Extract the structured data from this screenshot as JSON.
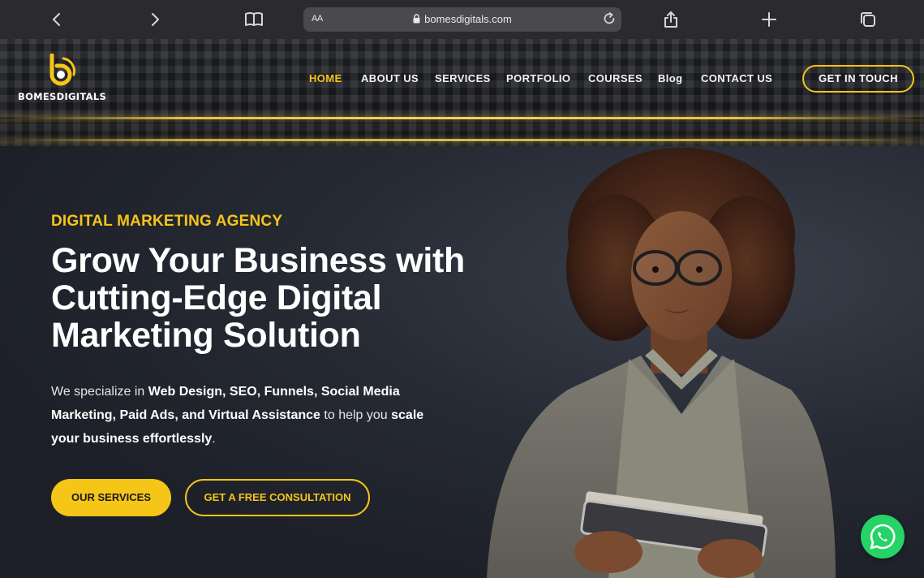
{
  "browser": {
    "url": "bomesdigitals.com",
    "text_size_label": "AA"
  },
  "logo": {
    "text": "BOMESDIGITALS",
    "mark_letter": "b"
  },
  "nav": {
    "items": [
      {
        "label": "HOME",
        "active": true
      },
      {
        "label": "ABOUT US",
        "active": false
      },
      {
        "label": "SERVICES",
        "active": false
      },
      {
        "label": "PORTFOLIO",
        "active": false
      },
      {
        "label": "COURSES",
        "active": false
      },
      {
        "label": "Blog",
        "active": false
      },
      {
        "label": "CONTACT US",
        "active": false
      }
    ],
    "cta_label": "GET IN TOUCH"
  },
  "hero": {
    "eyebrow": "DIGITAL MARKETING AGENCY",
    "headline_lines": [
      "Grow Your Business with",
      "Cutting-Edge Digital",
      "Marketing Solution"
    ],
    "intro": {
      "part1": "We specialize in ",
      "bold1": "Web Design, SEO, Funnels, Social Media Marketing, Paid Ads, and Virtual Assistance",
      "part2": " to help you ",
      "bold2": "scale your business effortlessly",
      "part3": "."
    },
    "primary_button": "OUR SERVICES",
    "secondary_button": "GET A FREE CONSULTATION"
  },
  "colors": {
    "accent": "#f5c518",
    "background": "#1d2028",
    "whatsapp": "#25d366"
  },
  "icons": {
    "back": "chevron-left-icon",
    "forward": "chevron-right-icon",
    "reader": "book-icon",
    "share": "share-icon",
    "new_tab": "plus-icon",
    "tabs": "tabs-icon",
    "reload": "reload-icon",
    "lock": "lock-icon",
    "chat": "whatsapp-icon"
  }
}
